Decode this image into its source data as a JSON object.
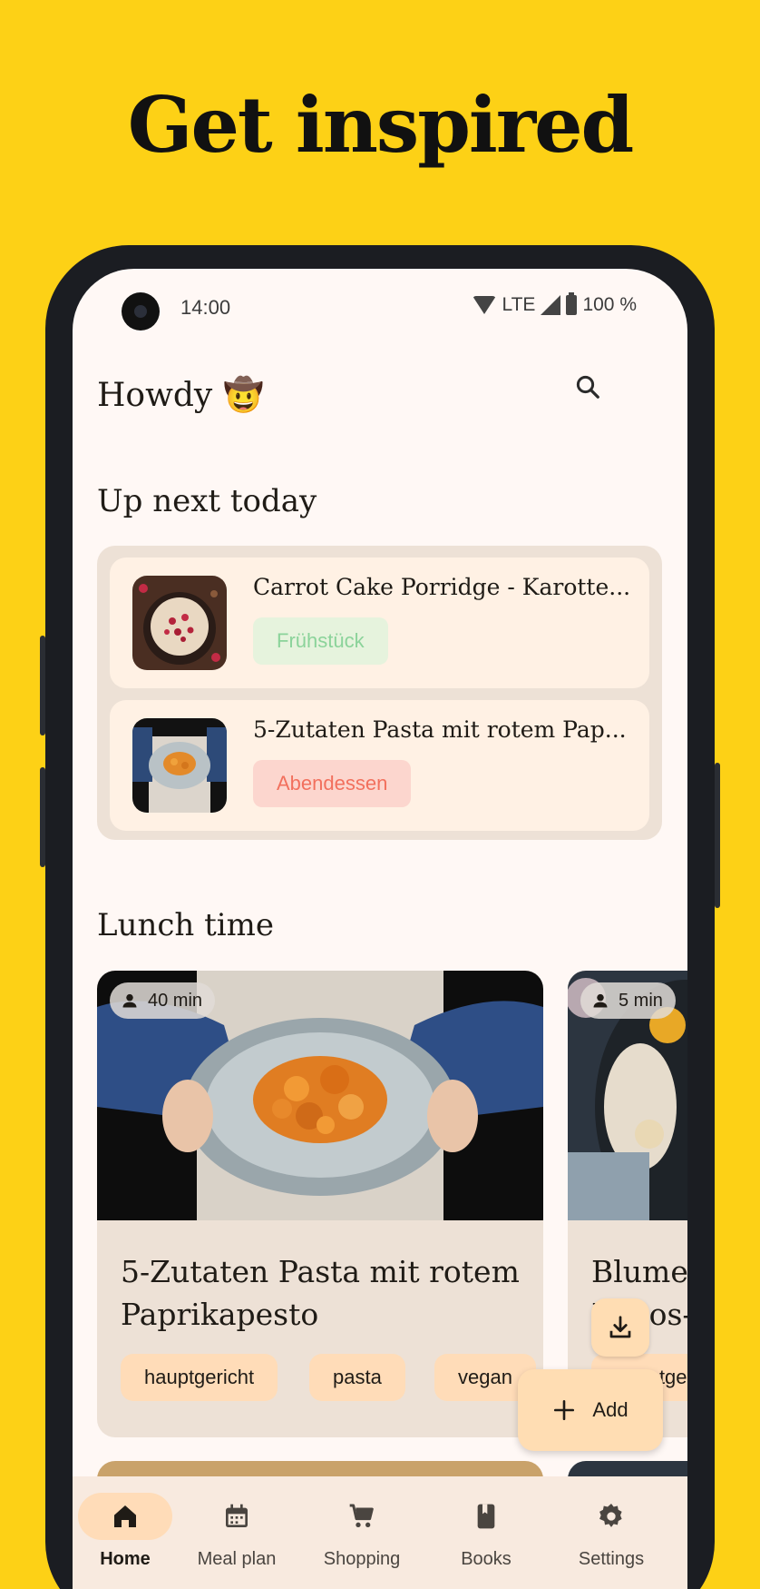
{
  "promo": {
    "title": "Get inspired"
  },
  "status_bar": {
    "time": "14:00",
    "network": "LTE",
    "battery": "100 %"
  },
  "header": {
    "greeting": "Howdy",
    "emoji": "🤠",
    "search_icon": "search-icon"
  },
  "up_next": {
    "title": "Up next today",
    "items": [
      {
        "title": "Carrot Cake Porridge - Karotte...",
        "tag": "Frühstück"
      },
      {
        "title": "5-Zutaten Pasta mit rotem Pap...",
        "tag": "Abendessen"
      }
    ]
  },
  "lunch": {
    "title": "Lunch time",
    "cards": [
      {
        "time": "40 min",
        "title": "5-Zutaten Pasta mit rotem Paprikapesto",
        "tags": [
          "hauptgericht",
          "pasta",
          "vegan"
        ]
      },
      {
        "time": "5 min",
        "title": "Blume\nKokos-",
        "tags": [
          "hauptge"
        ]
      }
    ]
  },
  "fab": {
    "add_label": "Add",
    "download_icon": "download-icon"
  },
  "bottom_nav": {
    "items": [
      {
        "label": "Home",
        "icon": "home-icon",
        "active": true
      },
      {
        "label": "Meal plan",
        "icon": "calendar-icon",
        "active": false
      },
      {
        "label": "Shopping",
        "icon": "cart-icon",
        "active": false
      },
      {
        "label": "Books",
        "icon": "book-icon",
        "active": false
      },
      {
        "label": "Settings",
        "icon": "gear-icon",
        "active": false
      }
    ]
  },
  "colors": {
    "background": "#FDD116",
    "surface": "#FFF8F5",
    "accent": "#FFDCB8"
  }
}
